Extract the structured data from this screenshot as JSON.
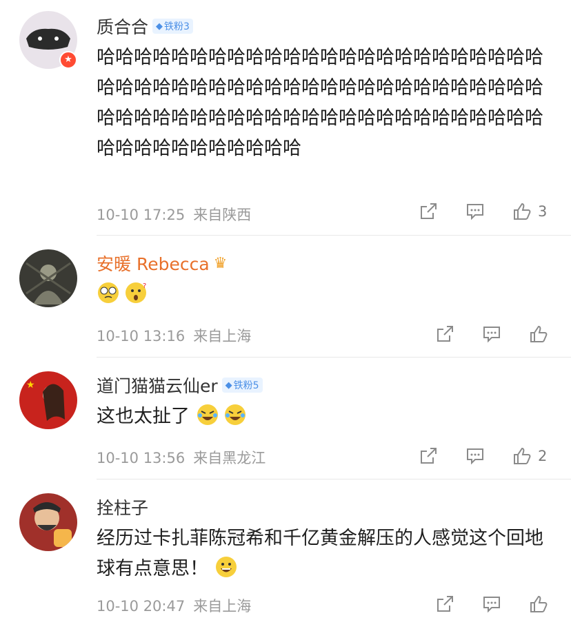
{
  "comments": [
    {
      "username": "质合合",
      "fan_badge": "铁粉3",
      "text": "哈哈哈哈哈哈哈哈哈哈哈哈哈哈哈哈哈哈哈哈哈哈哈哈哈哈哈哈哈哈哈哈哈哈哈哈哈哈哈哈哈哈哈哈哈哈哈哈哈哈哈哈哈哈哈哈哈哈哈哈哈哈哈哈哈哈哈哈哈哈哈哈哈哈哈哈哈哈哈哈哈哈哈",
      "time": "10-10 17:25",
      "location": "来自陕西",
      "likes": "3"
    },
    {
      "username": "安暖 Rebecca",
      "text": "",
      "emojis": [
        "dizzy-face",
        "confused-face"
      ],
      "time": "10-10 13:16",
      "location": "来自上海",
      "likes": ""
    },
    {
      "username": "道门猫猫云仙er",
      "fan_badge": "铁粉5",
      "text": "这也太扯了",
      "emojis": [
        "crying-laugh",
        "crying-laugh"
      ],
      "time": "10-10 13:56",
      "location": "来自黑龙江",
      "likes": "2"
    },
    {
      "username": "拴柱子",
      "text": "经历过卡扎菲陈冠希和千亿黄金解压的人感觉这个回地球有点意思！",
      "emojis": [
        "grin-face"
      ],
      "time": "10-10 20:47",
      "location": "来自上海",
      "likes": ""
    }
  ],
  "colors": {
    "meta_gray": "#9a9a9a",
    "vip_name": "#e8702a",
    "fan_badge_blue": "#4b8fe6",
    "verified_red": "#ff4b33"
  }
}
